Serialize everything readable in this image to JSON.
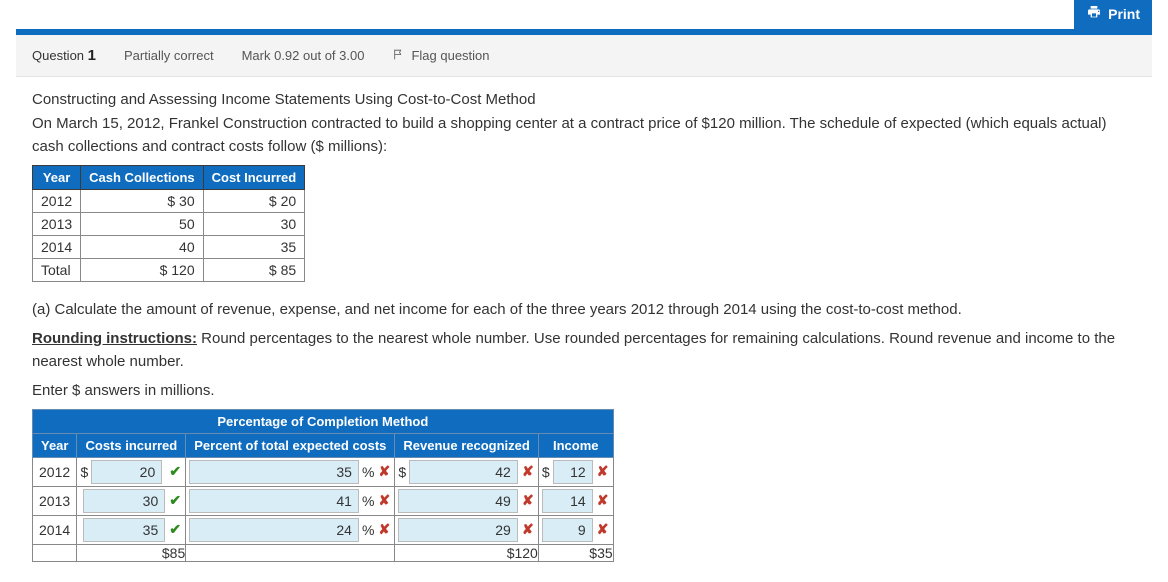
{
  "print_label": "Print",
  "header": {
    "question_prefix": "Question",
    "question_number": "1",
    "status": "Partially correct",
    "mark_text": "Mark 0.92 out of 3.00",
    "flag_text": "Flag question"
  },
  "body": {
    "title": "Constructing and Assessing Income Statements Using Cost-to-Cost Method",
    "intro": "On March 15, 2012, Frankel Construction contracted to build a shopping center at a contract price of $120 million. The schedule of expected (which equals actual) cash collections and contract costs follow ($ millions):",
    "table1": {
      "headers": [
        "Year",
        "Cash Collections",
        "Cost Incurred"
      ],
      "rows": [
        [
          "2012",
          "$ 30",
          "$ 20"
        ],
        [
          "2013",
          "50",
          "30"
        ],
        [
          "2014",
          "40",
          "35"
        ],
        [
          "Total",
          "$ 120",
          "$ 85"
        ]
      ]
    },
    "part_a": "(a) Calculate the amount of revenue, expense, and net income for each of the three years 2012 through 2014 using the cost-to-cost method.",
    "rounding_label": "Rounding instructions:",
    "rounding_text": " Round percentages to the nearest whole number. Use rounded percentages for remaining calculations. Round revenue and income to the nearest whole number.",
    "enter_text": "Enter $ answers in millions.",
    "table2": {
      "super_header": "Percentage of Completion Method",
      "headers": [
        "Year",
        "Costs incurred",
        "Percent of total expected costs",
        "Revenue recognized",
        "Income"
      ],
      "rows": [
        {
          "year": "2012",
          "costs": {
            "pre": "$",
            "val": "20",
            "suf": "",
            "mark": "correct"
          },
          "pct": {
            "pre": "",
            "val": "35",
            "suf": "%",
            "mark": "wrong"
          },
          "rev": {
            "pre": "$",
            "val": "42",
            "suf": "",
            "mark": "wrong"
          },
          "inc": {
            "pre": "$",
            "val": "12",
            "suf": "",
            "mark": "wrong"
          }
        },
        {
          "year": "2013",
          "costs": {
            "pre": "",
            "val": "30",
            "suf": "",
            "mark": "correct"
          },
          "pct": {
            "pre": "",
            "val": "41",
            "suf": "%",
            "mark": "wrong"
          },
          "rev": {
            "pre": "",
            "val": "49",
            "suf": "",
            "mark": "wrong"
          },
          "inc": {
            "pre": "",
            "val": "14",
            "suf": "",
            "mark": "wrong"
          }
        },
        {
          "year": "2014",
          "costs": {
            "pre": "",
            "val": "35",
            "suf": "",
            "mark": "correct"
          },
          "pct": {
            "pre": "",
            "val": "24",
            "suf": "%",
            "mark": "wrong"
          },
          "rev": {
            "pre": "",
            "val": "29",
            "suf": "",
            "mark": "wrong"
          },
          "inc": {
            "pre": "",
            "val": "9",
            "suf": "",
            "mark": "wrong"
          }
        }
      ],
      "totals": {
        "costs": "$85",
        "rev": "$120",
        "inc": "$35"
      }
    }
  },
  "chart_data": {
    "type": "table",
    "title": "Cash Collections and Cost Incurred ($ millions)",
    "columns": [
      "Year",
      "Cash Collections",
      "Cost Incurred"
    ],
    "rows": [
      [
        "2012",
        30,
        20
      ],
      [
        "2013",
        50,
        30
      ],
      [
        "2014",
        40,
        35
      ]
    ],
    "totals": {
      "Cash Collections": 120,
      "Cost Incurred": 85
    }
  }
}
